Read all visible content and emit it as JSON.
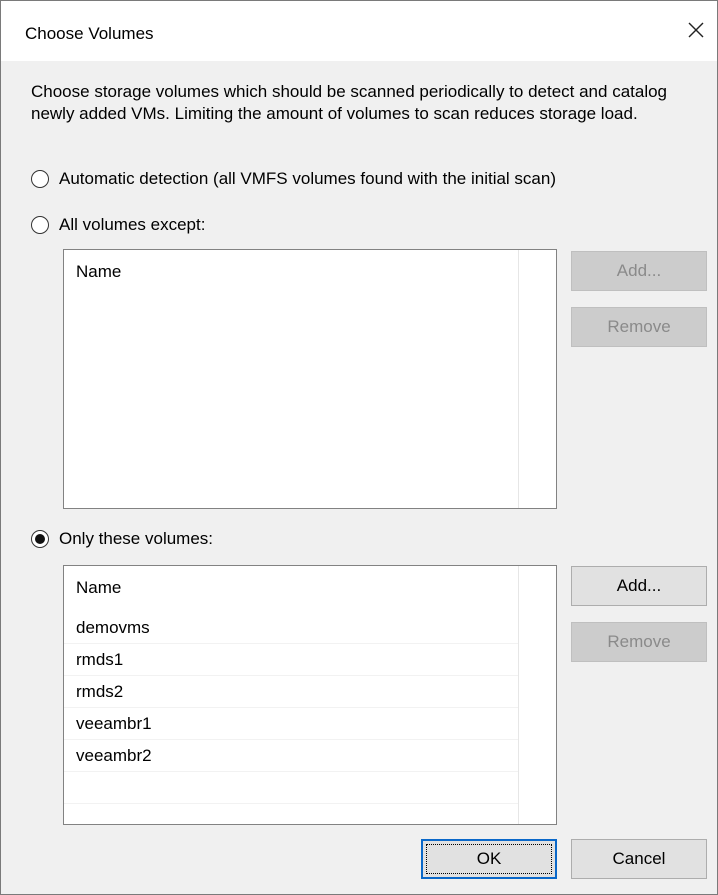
{
  "dialog": {
    "title": "Choose Volumes",
    "close_icon": "close-icon",
    "description": "Choose storage volumes which should be scanned periodically to detect and catalog newly added VMs. Limiting the amount of volumes to scan reduces storage load."
  },
  "options": {
    "automatic": {
      "label": "Automatic detection (all VMFS volumes found with the initial scan)",
      "selected": false
    },
    "all_except": {
      "label": "All volumes except:",
      "selected": false
    },
    "only_these": {
      "label": "Only these volumes:",
      "selected": true
    }
  },
  "except_list": {
    "header": "Name",
    "items": [],
    "add_label": "Add...",
    "remove_label": "Remove"
  },
  "only_list": {
    "header": "Name",
    "items": [
      "demovms",
      "rmds1",
      "rmds2",
      "veeambr1",
      "veeambr2"
    ],
    "add_label": "Add...",
    "remove_label": "Remove"
  },
  "footer": {
    "ok_label": "OK",
    "cancel_label": "Cancel"
  }
}
